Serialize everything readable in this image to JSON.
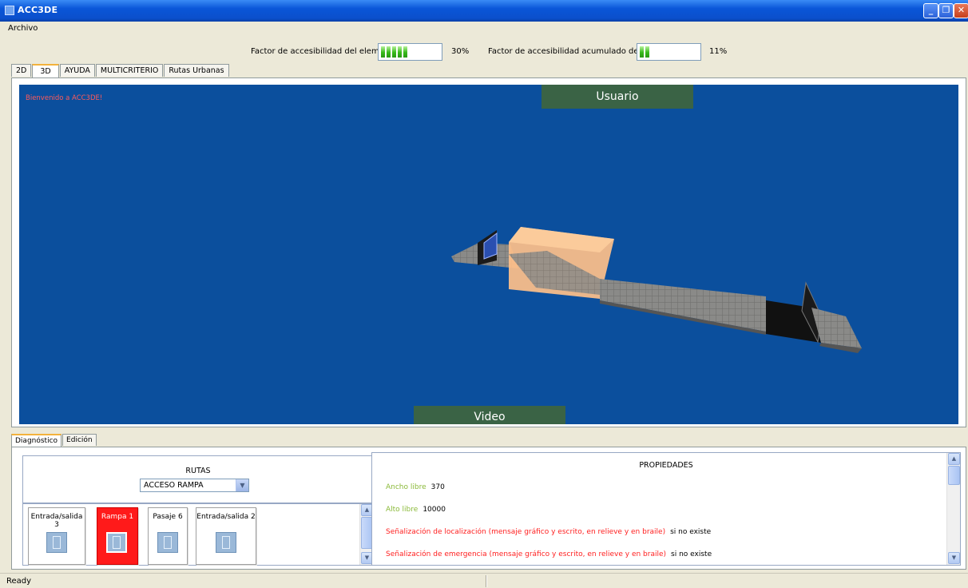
{
  "window": {
    "title": "ACC3DE",
    "icon": "app-icon",
    "buttons": [
      "minimize",
      "restore",
      "close"
    ]
  },
  "menu": {
    "items": [
      "Archivo"
    ]
  },
  "factors": {
    "element": {
      "label": "Factor de accesibilidad del elemento",
      "percent_text": "30%",
      "level": 0.3,
      "segments": 5
    },
    "route": {
      "label": "Factor de accesibilidad acumulado de la ruta",
      "percent_text": "11%",
      "level": 0.11,
      "segments": 2
    }
  },
  "tabs": [
    {
      "label": "2D",
      "active": false
    },
    {
      "label": "3D",
      "active": true
    },
    {
      "label": "AYUDA",
      "active": false
    },
    {
      "label": "MULTICRITERIO",
      "active": false
    },
    {
      "label": "Rutas Urbanas",
      "active": false
    }
  ],
  "viewport": {
    "welcome": "Bienvenido a ACC3DE!",
    "usuario": "Usuario",
    "video": "Video",
    "background": "#0b4f9d"
  },
  "bottom_tabs": [
    {
      "label": "Diagnóstico",
      "active": true
    },
    {
      "label": "Edición",
      "active": false
    }
  ],
  "rutas": {
    "title": "RUTAS",
    "selected": "ACCESO RAMPA",
    "items": [
      {
        "label": "Entrada/salida 3",
        "icon": "door-icon",
        "selected": false
      },
      {
        "label": "Rampa 1",
        "icon": "ramp-icon",
        "selected": true
      },
      {
        "label": "Pasaje 6",
        "icon": "walkway-icon",
        "selected": false
      },
      {
        "label": "Entrada/salida 2",
        "icon": "door-icon",
        "selected": false
      }
    ]
  },
  "properties": {
    "title": "PROPIEDADES",
    "rows": [
      {
        "label": "Ancho libre",
        "value": "370",
        "status": "ok"
      },
      {
        "label": "Alto libre",
        "value": "10000",
        "status": "ok"
      },
      {
        "label": "Señalización de localización (mensaje gráfico y escrito, en relieve y en braile)",
        "value": "si no existe",
        "status": "bad"
      },
      {
        "label": "Señalización de emergencia (mensaje gráfico y escrito, en relieve y en braile)",
        "value": "si no existe",
        "status": "bad"
      }
    ]
  },
  "colors": {
    "title_bar": "#0b4fcc",
    "usuario_button": "#3a6345",
    "selected_route": "#ff1a1a",
    "ok_label": "#8bba3a",
    "bad_label": "#ff2020"
  },
  "status": {
    "text": "Ready"
  }
}
